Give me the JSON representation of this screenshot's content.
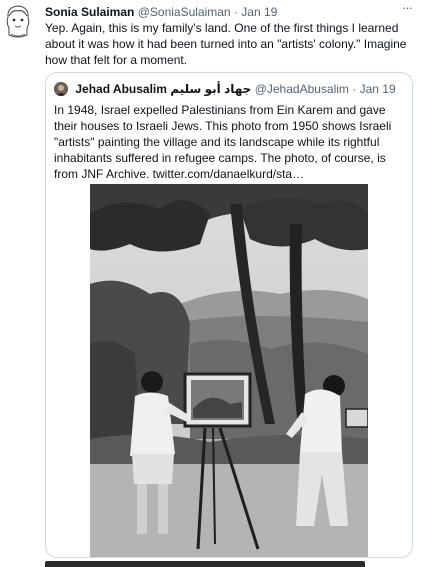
{
  "tweet": {
    "author_name": "Sonia Sulaiman",
    "handle": "@SoniaSulaiman",
    "separator": "·",
    "date": "Jan 19",
    "more": "···",
    "text": "Yep. Again, this is my family's land. One of the first things I learned about it was how it had been turned into an \"artists' colony.\" Imagine how that felt for a moment."
  },
  "quoted": {
    "author_name": "Jehad Abusalim",
    "author_name_arabic": "جهاد أبو سليم",
    "handle": "@JehadAbusalim",
    "separator": "·",
    "date": "Jan 19",
    "text": "In 1948, Israel expelled Palestinians from Ein Karem and gave their houses to Israeli Jews. This photo from 1950 shows Israeli \"artists\" painting the village and its landscape while its rightful inhabitants suffered in refugee camps. The photo, of course, is from JNF Archive. twitter.com/danaelkurd/sta…"
  },
  "colors": {
    "text": "#0f1419",
    "muted": "#536471",
    "border": "#cfd9de"
  },
  "icons": {
    "avatar": "sketch-avatar-icon",
    "more": "more-options-icon"
  }
}
